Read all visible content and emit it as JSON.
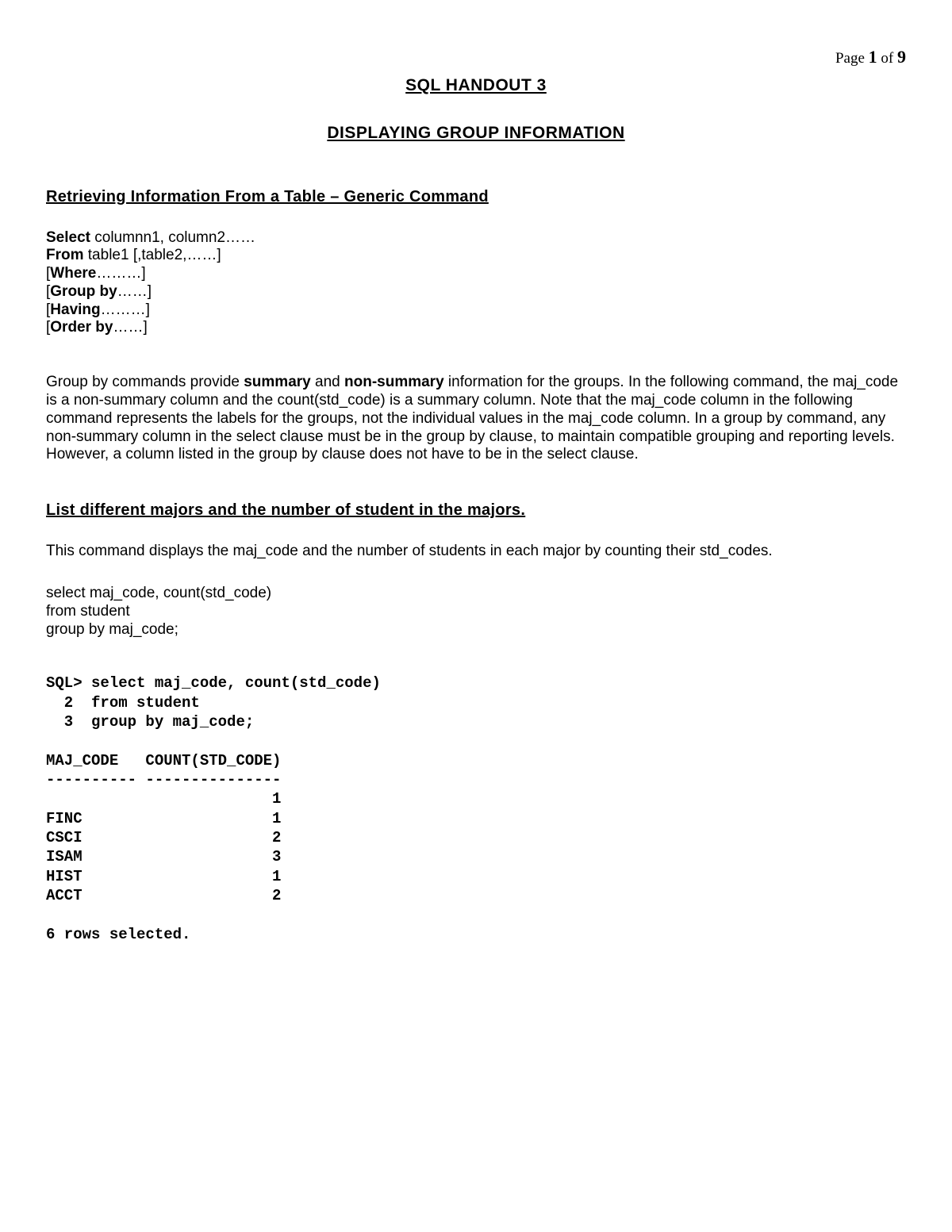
{
  "page": {
    "label_prefix": "Page ",
    "current": "1",
    "of": " of ",
    "total": "9"
  },
  "title1": "SQL HANDOUT 3",
  "title2": "DISPLAYING GROUP INFORMATION",
  "section1_heading": "Retrieving Information From a Table – Generic Command",
  "syntax": {
    "l1_kw": "Select ",
    "l1_rest": "columnn1, column2……",
    "l2_kw": "From ",
    "l2_rest": "table1 [,table2,……]",
    "l3_open": "[",
    "l3_kw": "Where",
    "l3_rest": "………]",
    "l4_open": "[",
    "l4_kw": "Group by",
    "l4_rest": "……]",
    "l5_open": "[",
    "l5_kw": "Having",
    "l5_rest": "………]",
    "l6_open": "[",
    "l6_kw": "Order by",
    "l6_rest": "……]"
  },
  "para1": {
    "pre1": "Group by commands provide ",
    "kw1": "summary",
    "mid1": " and ",
    "kw2": "non-summary",
    "post": " information for the groups.  In the following command, the maj_code is a non-summary column and the count(std_code) is a summary column.  Note that the maj_code column in the following command represents the labels for the groups, not the individual values in the maj_code column.  In a group by command, any non-summary column in the select clause must be in the group by clause, to maintain compatible grouping and reporting levels.  However, a column listed in the group by clause does not have to be in the select clause."
  },
  "section2_heading": "List different majors and the number of student in the majors.",
  "para2": "This command displays the maj_code and the number of students in each major by counting their std_codes.",
  "query": {
    "l1": "select maj_code, count(std_code)",
    "l2": "from student",
    "l3": "group by maj_code;"
  },
  "sql_output": "SQL> select maj_code, count(std_code)\n  2  from student\n  3  group by maj_code;\n\nMAJ_CODE   COUNT(STD_CODE)\n---------- ---------------\n                         1\nFINC                     1\nCSCI                     2\nISAM                     3\nHIST                     1\nACCT                     2\n\n6 rows selected."
}
